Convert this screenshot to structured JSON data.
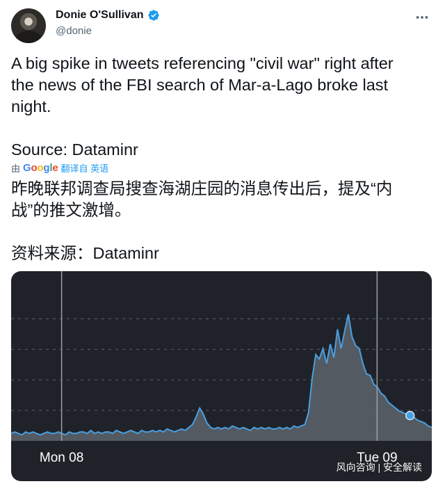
{
  "author": {
    "name": "Donie O'Sullivan",
    "handle": "@donie",
    "verified": true,
    "avatar_icon": "person-photo"
  },
  "tweet": {
    "text": "A big spike in tweets referencing \"civil war\" right after\nthe news of the FBI search of Mar-a-Lago broke last\nnight.\n\nSource: Dataminr",
    "translation_prefix": "由",
    "translation_provider": "Google",
    "translation_label": "翻译自 英语",
    "translated_text": "昨晚联邦调查局搜查海湖庄园的消息传出后，提及“内\n战”的推文激增。\n\n资料来源：Dataminr"
  },
  "watermark": "风向咨询 | 安全解读",
  "colors": {
    "chart_bg": "#1f2329",
    "line": "#4a9fe0",
    "fill": "#5a6068",
    "verified": "#1d9bf0"
  },
  "chart_data": {
    "type": "area",
    "title": "",
    "xlabel": "",
    "ylabel": "",
    "x_tick_labels": [
      "Mon 08",
      "Tue 09"
    ],
    "x_tick_positions": [
      0.12,
      0.87
    ],
    "ylim": [
      0,
      100
    ],
    "grid": true,
    "legend": "none",
    "values": [
      5,
      6,
      5,
      4,
      6,
      5,
      6,
      5,
      4,
      5,
      6,
      5,
      5,
      6,
      5,
      4,
      6,
      5,
      5,
      6,
      6,
      5,
      7,
      5,
      6,
      5,
      6,
      6,
      5,
      7,
      6,
      5,
      6,
      7,
      6,
      5,
      7,
      6,
      6,
      7,
      6,
      7,
      6,
      8,
      7,
      6,
      7,
      8,
      7,
      9,
      11,
      16,
      22,
      18,
      12,
      9,
      8,
      9,
      8,
      9,
      8,
      10,
      9,
      8,
      9,
      8,
      7,
      9,
      8,
      9,
      8,
      9,
      8,
      8,
      9,
      8,
      9,
      8,
      10,
      9,
      10,
      11,
      19,
      42,
      58,
      55,
      62,
      52,
      65,
      56,
      75,
      62,
      74,
      85,
      70,
      64,
      62,
      52,
      45,
      44,
      38,
      36,
      32,
      30,
      26,
      24,
      22,
      20,
      19,
      18,
      17,
      16,
      14,
      13,
      12,
      10,
      9
    ],
    "highlight_point_index": 110
  }
}
